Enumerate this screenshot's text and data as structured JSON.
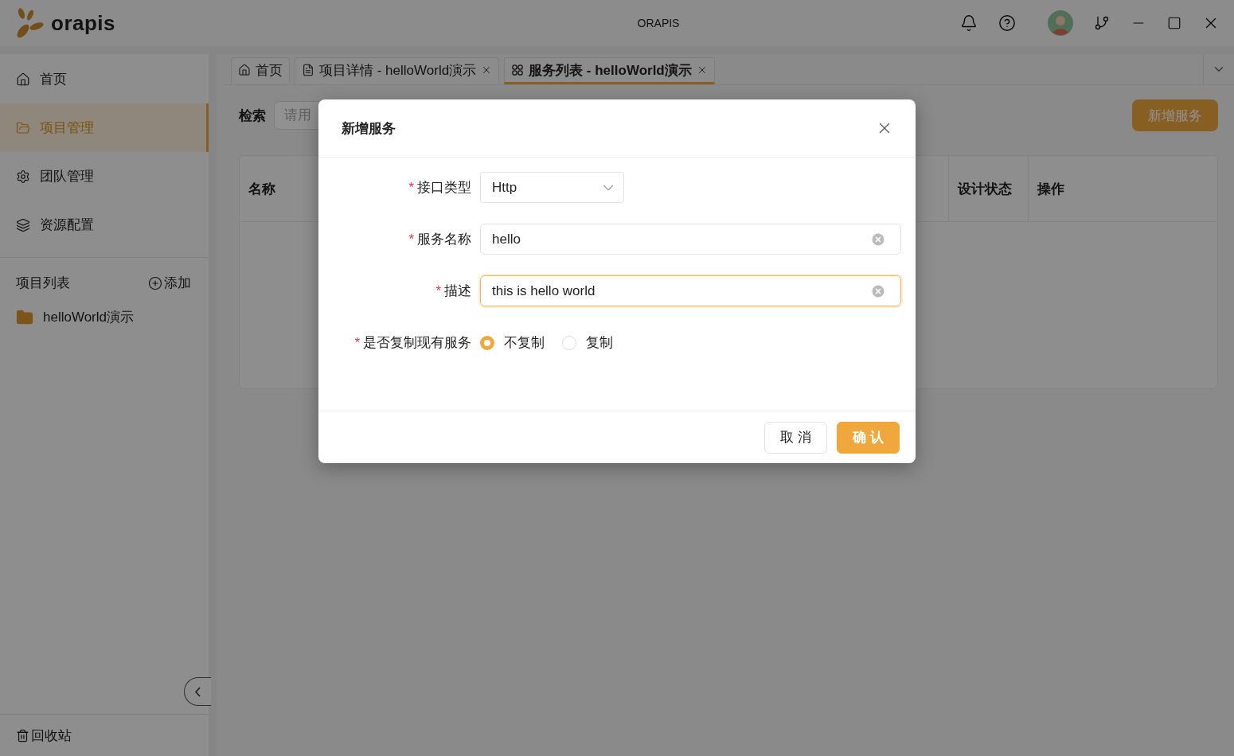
{
  "titlebar": {
    "logo_text": "orapis",
    "title": "ORAPIS"
  },
  "sidebar": {
    "nav": [
      {
        "label": "首页",
        "selected": false
      },
      {
        "label": "项目管理",
        "selected": true
      },
      {
        "label": "团队管理",
        "selected": false
      },
      {
        "label": "资源配置",
        "selected": false
      }
    ],
    "project_list": {
      "title": "项目列表",
      "add": "添加",
      "items": [
        {
          "label": "helloWorld演示"
        }
      ]
    },
    "recycle": "回收站"
  },
  "tabs": [
    {
      "label": "首页",
      "closable": false,
      "selected": false
    },
    {
      "label": "项目详情 - helloWorld演示",
      "closable": true,
      "selected": false
    },
    {
      "label": "服务列表 - helloWorld演示",
      "closable": true,
      "selected": true
    }
  ],
  "toolbar": {
    "search_label": "检索",
    "search_placeholder": "请用",
    "add_button": "新增服务"
  },
  "table": {
    "columns": [
      "名称",
      "设计状态",
      "操作"
    ]
  },
  "dialog": {
    "title": "新增服务",
    "fields": [
      {
        "kind": "select",
        "required_mark": "*",
        "label": "接口类型",
        "value": "Http"
      },
      {
        "kind": "input",
        "required_mark": "*",
        "label": "服务名称",
        "value": "hello",
        "focused": false
      },
      {
        "kind": "input",
        "required_mark": "*",
        "label": "描述",
        "value": "this is hello world",
        "focused": true
      },
      {
        "kind": "radio",
        "required_mark": "*",
        "label": "是否复制现有服务",
        "options": [
          {
            "label": "不复制",
            "selected": true
          },
          {
            "label": "复制",
            "selected": false
          }
        ]
      }
    ],
    "cancel": "取 消",
    "confirm": "确 认"
  }
}
